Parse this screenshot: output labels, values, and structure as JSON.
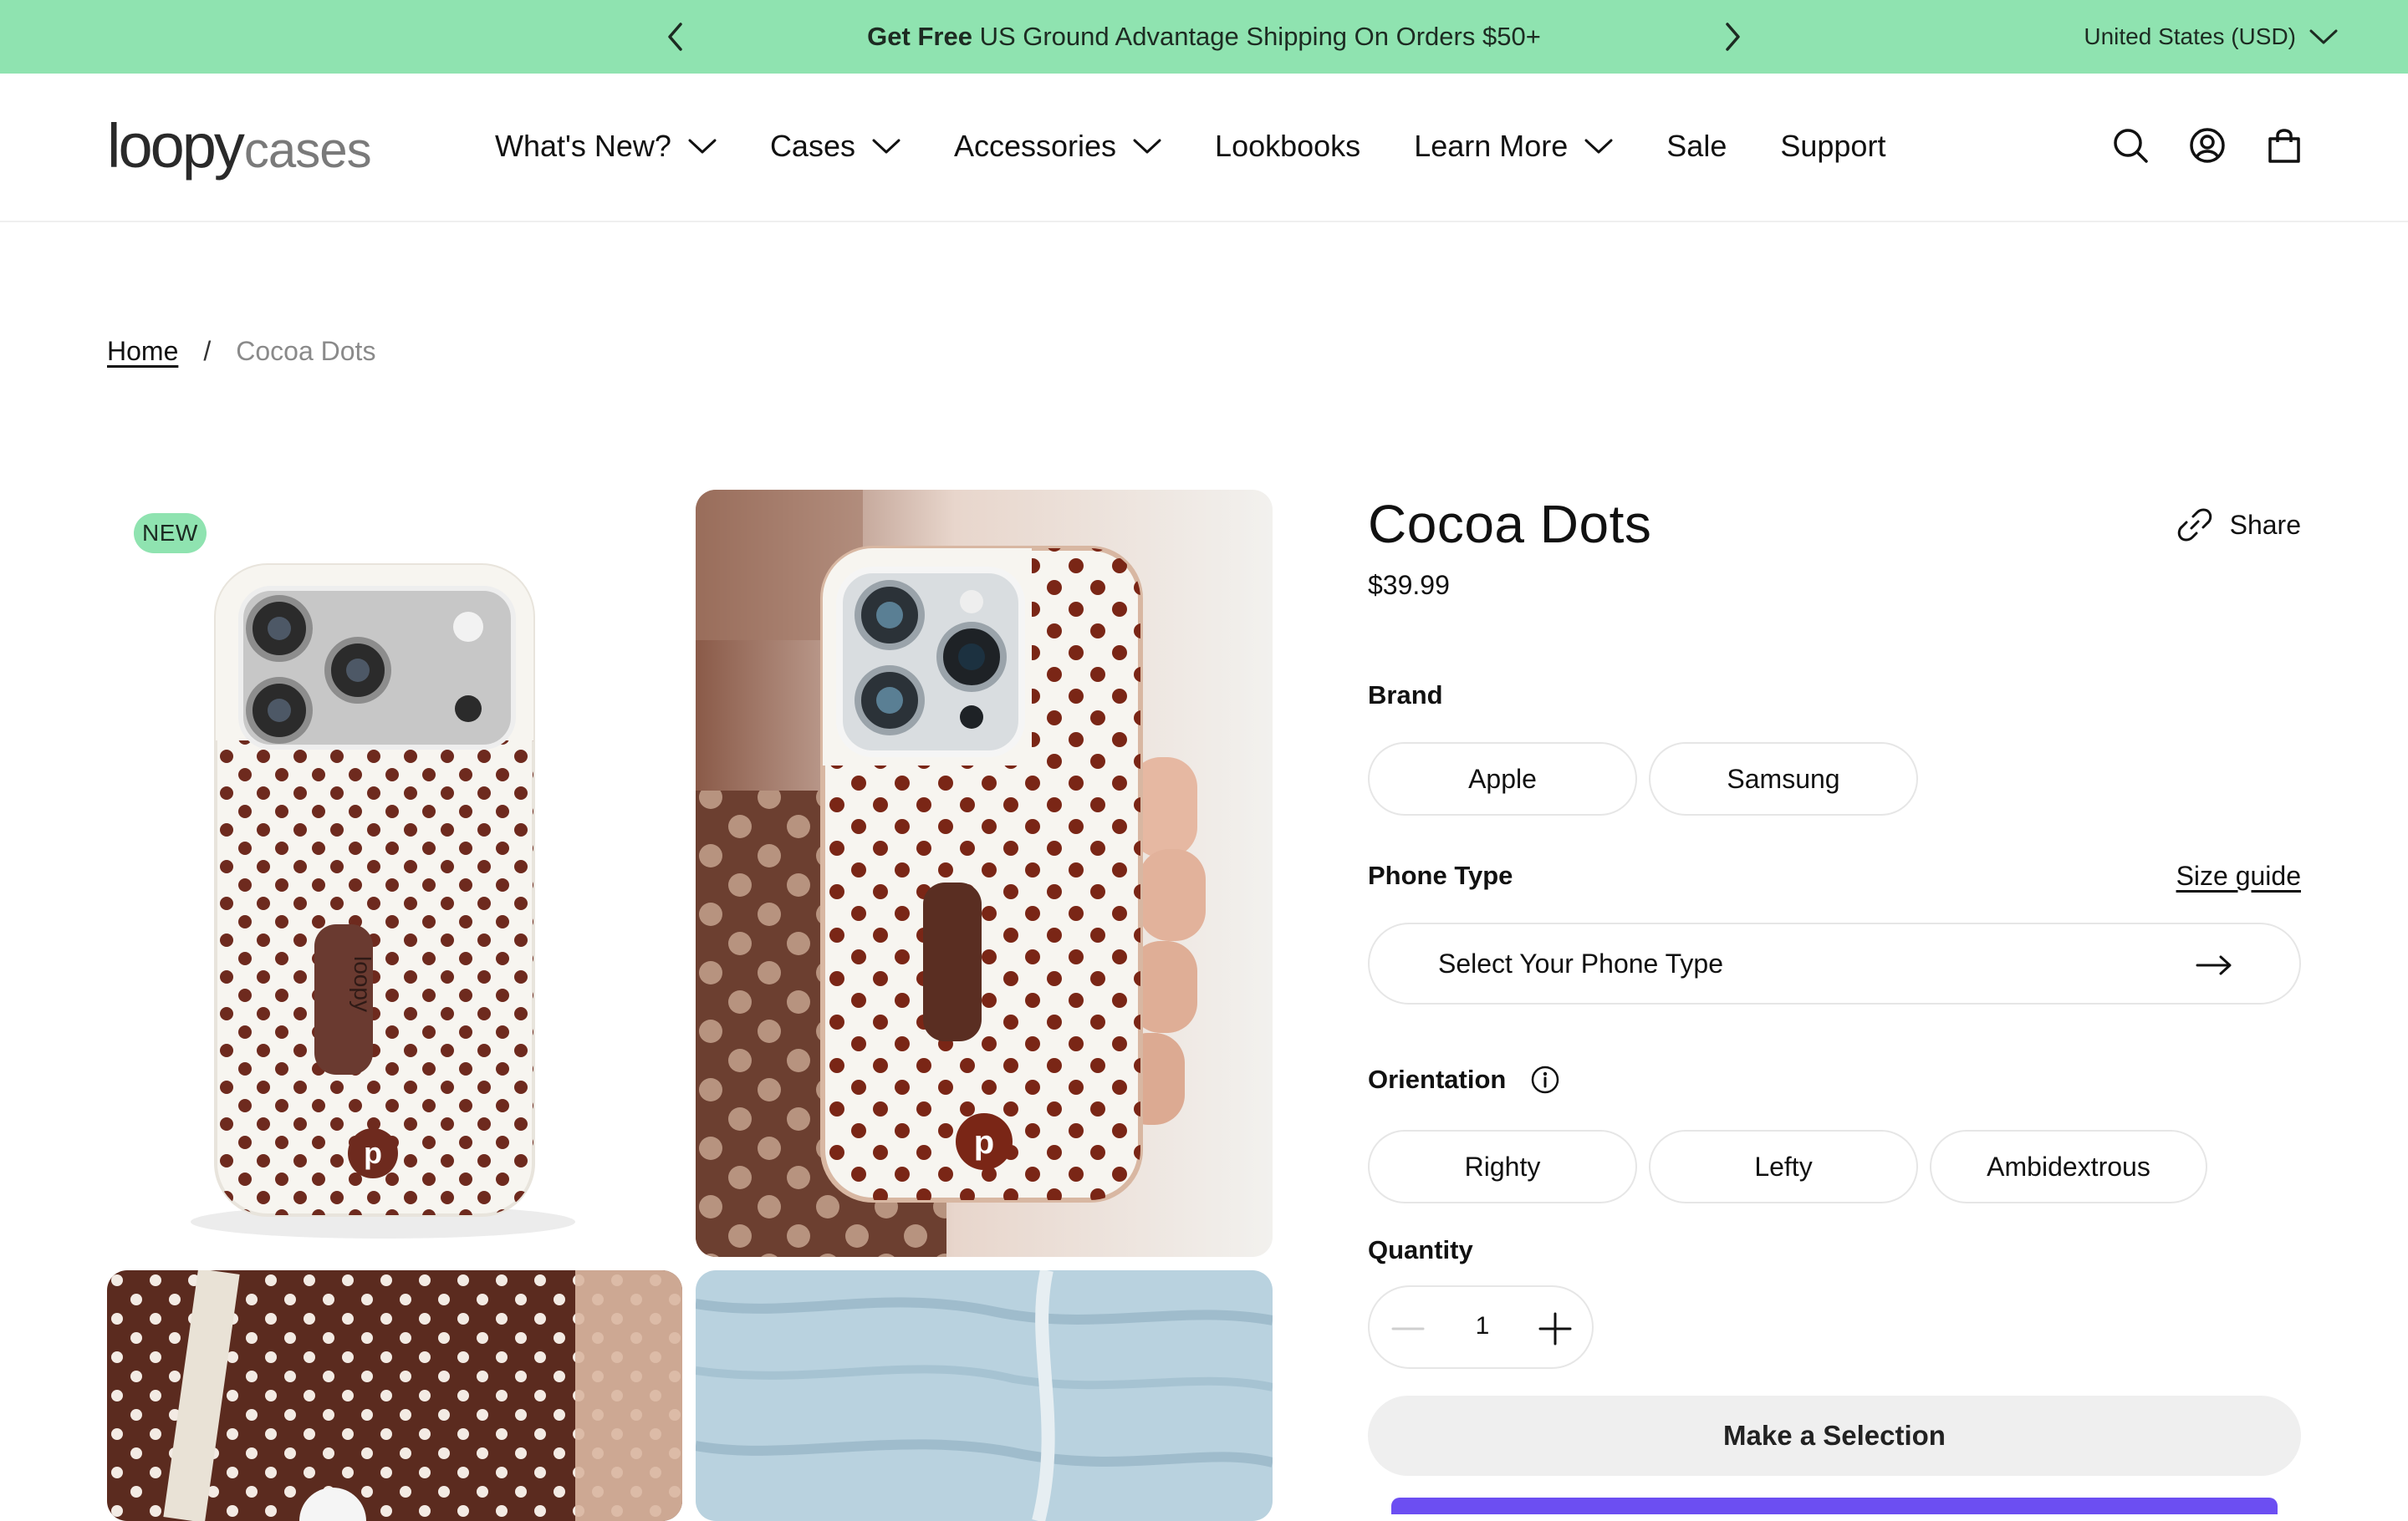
{
  "announcement": {
    "bold": "Get Free",
    "text": " US Ground Advantage Shipping On Orders $50+",
    "currency": "United States (USD)"
  },
  "header": {
    "logo_part1": "loopy",
    "logo_part2": "cases",
    "nav": [
      {
        "label": "What's New?",
        "has_dropdown": true
      },
      {
        "label": "Cases",
        "has_dropdown": true
      },
      {
        "label": "Accessories",
        "has_dropdown": true
      },
      {
        "label": "Lookbooks",
        "has_dropdown": false
      },
      {
        "label": "Learn More",
        "has_dropdown": true
      },
      {
        "label": "Sale",
        "has_dropdown": false
      },
      {
        "label": "Support",
        "has_dropdown": false
      }
    ],
    "icons": [
      "search-icon",
      "account-icon",
      "cart-icon"
    ]
  },
  "breadcrumb": {
    "home": "Home",
    "separator": "/",
    "current": "Cocoa Dots"
  },
  "gallery": {
    "badge": "NEW",
    "case_brand_text": "loopy"
  },
  "product": {
    "title": "Cocoa Dots",
    "price": "$39.99",
    "share_label": "Share",
    "brand_label": "Brand",
    "brand_options": [
      "Apple",
      "Samsung"
    ],
    "phone_type_label": "Phone Type",
    "size_guide": "Size guide",
    "phone_type_placeholder": "Select Your Phone Type",
    "orientation_label": "Orientation",
    "orientation_options": [
      "Righty",
      "Lefty",
      "Ambidextrous"
    ],
    "quantity_label": "Quantity",
    "quantity": "1",
    "cta": "Make a Selection"
  },
  "colors": {
    "announcement_bg": "#8fe3b0",
    "dot_brown": "#6e2a1e",
    "case_white": "#f7f5f0",
    "cta_bg": "#efefef",
    "accent_purple": "#6c4ef2"
  }
}
